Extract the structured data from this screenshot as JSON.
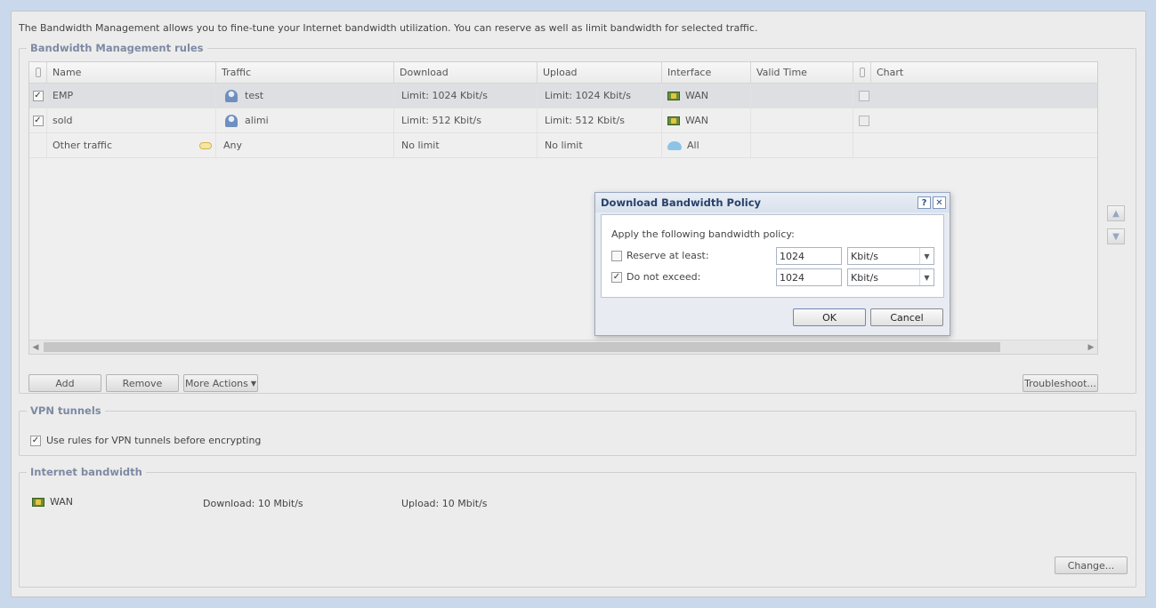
{
  "intro": "The Bandwidth Management allows you to fine-tune your Internet bandwidth utilization. You can reserve as well as limit bandwidth for selected traffic.",
  "rules": {
    "legend": "Bandwidth Management rules",
    "columns": {
      "name": "Name",
      "traffic": "Traffic",
      "download": "Download",
      "upload": "Upload",
      "interface": "Interface",
      "valid_time": "Valid Time",
      "chart": "Chart"
    },
    "rows": [
      {
        "enabled": true,
        "name": "EMP",
        "traffic": "test",
        "download": "Limit: 1024 Kbit/s",
        "upload": "Limit: 1024 Kbit/s",
        "interface": "WAN",
        "valid_time": "",
        "chart": false
      },
      {
        "enabled": true,
        "name": "sold",
        "traffic": "alimi",
        "download": "Limit: 512 Kbit/s",
        "upload": "Limit: 512 Kbit/s",
        "interface": "WAN",
        "valid_time": "",
        "chart": false
      },
      {
        "name": "Other traffic",
        "traffic": "Any",
        "download": "No limit",
        "upload": "No limit",
        "interface": "All"
      }
    ],
    "buttons": {
      "add": "Add",
      "remove": "Remove",
      "more": "More Actions",
      "troubleshoot": "Troubleshoot..."
    }
  },
  "vpn": {
    "legend": "VPN tunnels",
    "checkbox_label": "Use rules for VPN tunnels before encrypting",
    "checked": true
  },
  "internet": {
    "legend": "Internet bandwidth",
    "interface": "WAN",
    "download": "Download: 10 Mbit/s",
    "upload": "Upload: 10 Mbit/s",
    "change": "Change..."
  },
  "dialog": {
    "title": "Download Bandwidth Policy",
    "help": "?",
    "close": "✕",
    "prompt": "Apply the following bandwidth policy:",
    "reserve": {
      "label": "Reserve at least:",
      "checked": false,
      "value": "1024",
      "unit": "Kbit/s"
    },
    "exceed": {
      "label": "Do not exceed:",
      "checked": true,
      "value": "1024",
      "unit": "Kbit/s"
    },
    "ok": "OK",
    "cancel": "Cancel"
  }
}
